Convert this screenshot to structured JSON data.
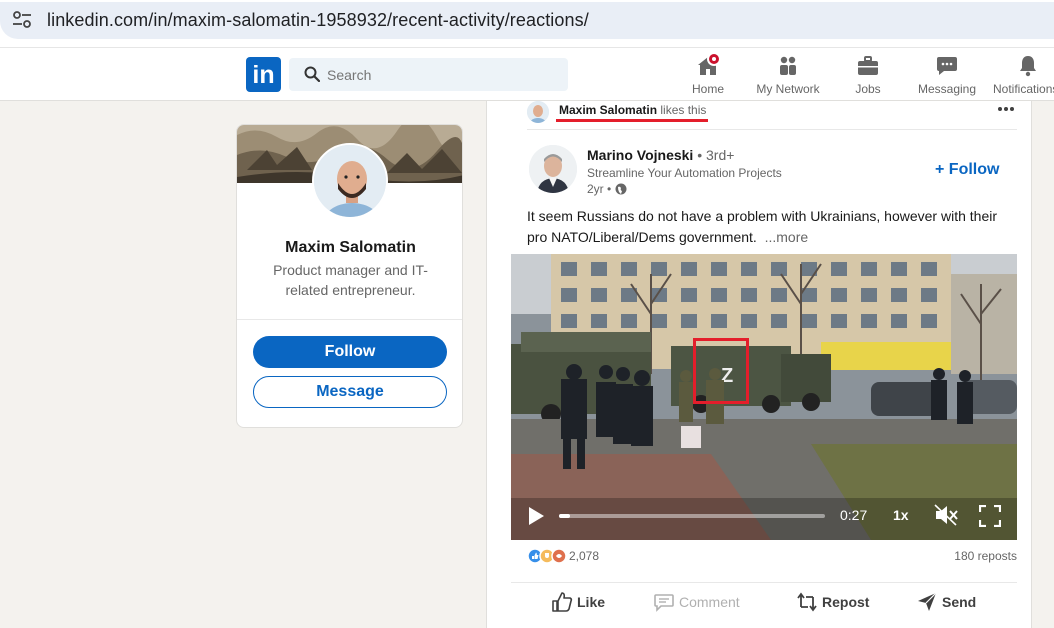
{
  "browser": {
    "url": "linkedin.com/in/maxim-salomatin-1958932/recent-activity/reactions/"
  },
  "nav": {
    "logo": "in",
    "search_placeholder": "Search",
    "items": [
      {
        "label": "Home",
        "icon": "home-icon"
      },
      {
        "label": "My Network",
        "icon": "network-icon"
      },
      {
        "label": "Jobs",
        "icon": "briefcase-icon"
      },
      {
        "label": "Messaging",
        "icon": "chat-icon"
      },
      {
        "label": "Notifications",
        "icon": "bell-icon"
      }
    ]
  },
  "profile": {
    "name": "Maxim Salomatin",
    "headline": "Product manager and IT-related entrepreneur.",
    "follow_label": "Follow",
    "message_label": "Message"
  },
  "post": {
    "activity_name": "Maxim Salomatin",
    "activity_action": "likes this",
    "author_name": "Marino Vojneski",
    "author_degree": "• 3rd+",
    "author_headline": "Streamline Your Automation Projects",
    "author_time": "2yr •",
    "follow_label": "+ Follow",
    "text": "It seem Russians do not have a problem with Ukrainians, however with their pro NATO/Liberal/Dems government.",
    "see_more": "...more",
    "video": {
      "time": "0:27",
      "speed": "1x",
      "progress": 0.04
    },
    "reactions_count": "2,078",
    "reposts": "180 reposts",
    "actions": {
      "like": "Like",
      "comment": "Comment",
      "repost": "Repost",
      "send": "Send"
    }
  },
  "colors": {
    "brand": "#0a66c2",
    "highlight": "#e41e2b"
  }
}
